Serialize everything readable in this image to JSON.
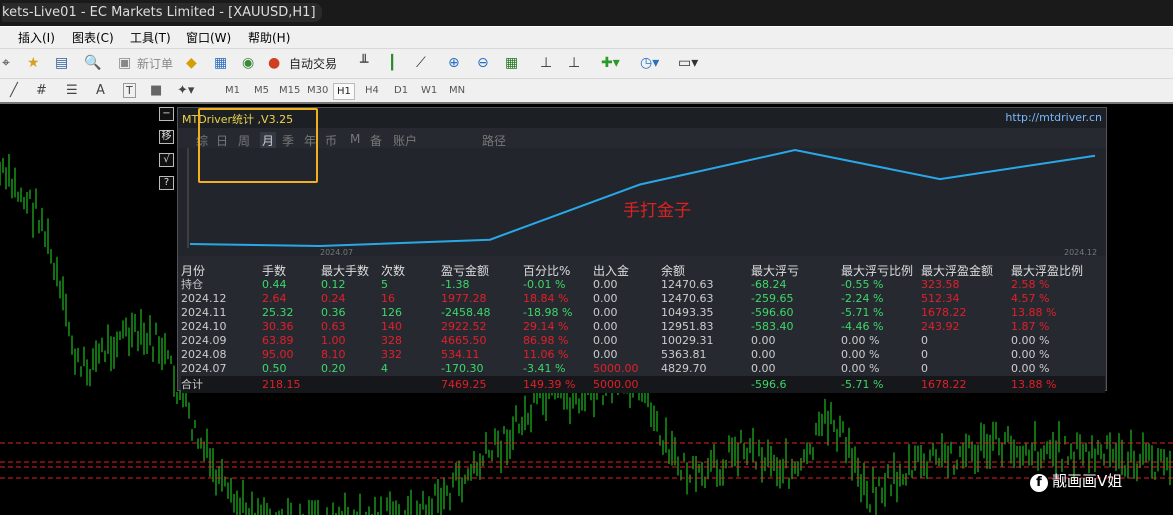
{
  "window": {
    "title": "kets-Live01 - EC Markets Limited - [XAUUSD,H1]"
  },
  "menu": [
    "插入(I)",
    "图表(C)",
    "工具(T)",
    "窗口(W)",
    "帮助(H)"
  ],
  "toolbar": {
    "new_order": "新订单",
    "auto_trading": "自动交易"
  },
  "drawing_tools": {
    "text_tool": "A",
    "label_tool": "T"
  },
  "timeframes": [
    "M1",
    "M5",
    "M15",
    "M30",
    "H1",
    "H4",
    "D1",
    "W1",
    "MN"
  ],
  "selected_timeframe": "H1",
  "side_buttons": [
    "−",
    "移",
    "√",
    "?"
  ],
  "panel": {
    "title": "MTDriver统计 ,V3.25",
    "link": "http://mtdriver.cn",
    "tabs": [
      "综",
      "日",
      "周",
      "月",
      "季",
      "年",
      "币",
      "M",
      "备",
      "账户",
      "路径"
    ],
    "active_tab": "月",
    "graph_label": "手打金子",
    "graph_x_start": "2024.07",
    "graph_x_end": "2024.12",
    "equity_curve": [
      5000,
      4829.7,
      5363.81,
      10029.31,
      12951.83,
      10493.35,
      12470.63
    ],
    "columns": [
      "月份",
      "手数",
      "最大手数",
      "次数",
      "盈亏金额",
      "百分比%",
      "出入金",
      "余额",
      "最大浮亏",
      "最大浮亏比例",
      "最大浮盈金额",
      "最大浮盈比例"
    ],
    "rows": [
      [
        "持仓",
        "0.44",
        "0.12",
        "5",
        "-1.38",
        "-0.01 %",
        "0.00",
        "12470.63",
        "-68.24",
        "-0.55 %",
        "323.58",
        "2.58 %"
      ],
      [
        "2024.12",
        "2.64",
        "0.24",
        "16",
        "1977.28",
        "18.84 %",
        "0.00",
        "12470.63",
        "-259.65",
        "-2.24 %",
        "512.34",
        "4.57 %"
      ],
      [
        "2024.11",
        "25.32",
        "0.36",
        "126",
        "-2458.48",
        "-18.98 %",
        "0.00",
        "10493.35",
        "-596.60",
        "-5.71 %",
        "1678.22",
        "13.88 %"
      ],
      [
        "2024.10",
        "30.36",
        "0.63",
        "140",
        "2922.52",
        "29.14 %",
        "0.00",
        "12951.83",
        "-583.40",
        "-4.46 %",
        "243.92",
        "1.87 %"
      ],
      [
        "2024.09",
        "63.89",
        "1.00",
        "328",
        "4665.50",
        "86.98 %",
        "0.00",
        "10029.31",
        "0.00",
        "0.00 %",
        "0",
        "0.00 %"
      ],
      [
        "2024.08",
        "95.00",
        "8.10",
        "332",
        "534.11",
        "11.06 %",
        "0.00",
        "5363.81",
        "0.00",
        "0.00 %",
        "0",
        "0.00 %"
      ],
      [
        "2024.07",
        "0.50",
        "0.20",
        "4",
        "-170.30",
        "-3.41 %",
        "5000.00",
        "4829.70",
        "0.00",
        "0.00 %",
        "0",
        "0.00 %"
      ]
    ],
    "total": [
      "合计",
      "218.15",
      "",
      "",
      "7469.25",
      "149.39 %",
      "5000.00",
      "",
      "-596.6",
      "-5.71 %",
      "1678.22",
      "13.88 %"
    ]
  },
  "watermark": "靓画画V姐",
  "colors": {
    "profit": "#e0202a",
    "loss": "#3fd66a",
    "candles": "#22e022",
    "level": "#e02020",
    "highlight": "#f2b01e"
  }
}
